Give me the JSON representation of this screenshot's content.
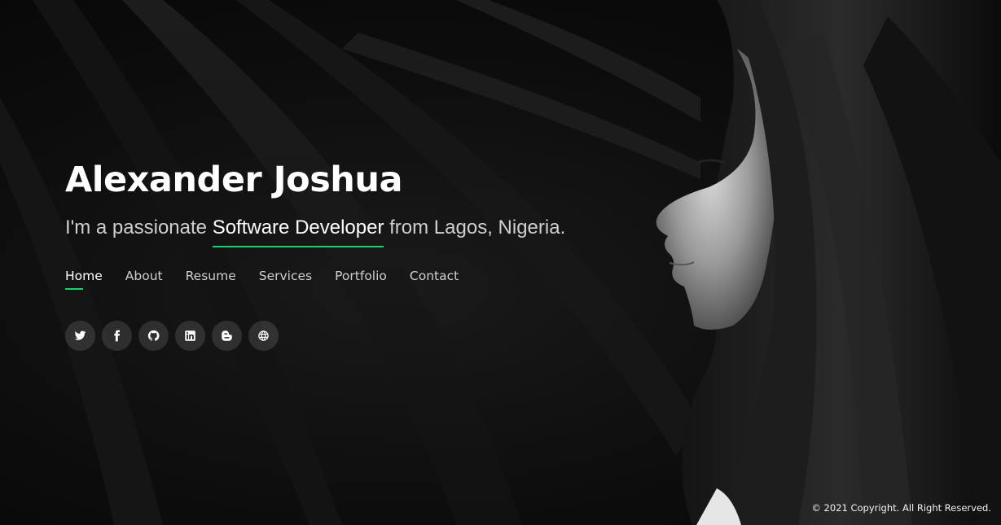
{
  "colors": {
    "accent": "#18d26e",
    "background": "#0a0a0a"
  },
  "hero": {
    "name": "Alexander Joshua",
    "tagline_prefix": "I'm a passionate ",
    "tagline_role": "Software Developer",
    "tagline_suffix": " from Lagos, Nigeria."
  },
  "nav": {
    "items": [
      {
        "label": "Home",
        "active": true
      },
      {
        "label": "About"
      },
      {
        "label": "Resume"
      },
      {
        "label": "Services"
      },
      {
        "label": "Portfolio"
      },
      {
        "label": "Contact"
      }
    ]
  },
  "social": {
    "items": [
      {
        "icon": "twitter-icon"
      },
      {
        "icon": "facebook-icon"
      },
      {
        "icon": "github-icon"
      },
      {
        "icon": "linkedin-icon"
      },
      {
        "icon": "blogger-icon"
      },
      {
        "icon": "website-icon"
      }
    ]
  },
  "footer": {
    "copyright": "© 2021 Copyright. All Right Reserved."
  }
}
